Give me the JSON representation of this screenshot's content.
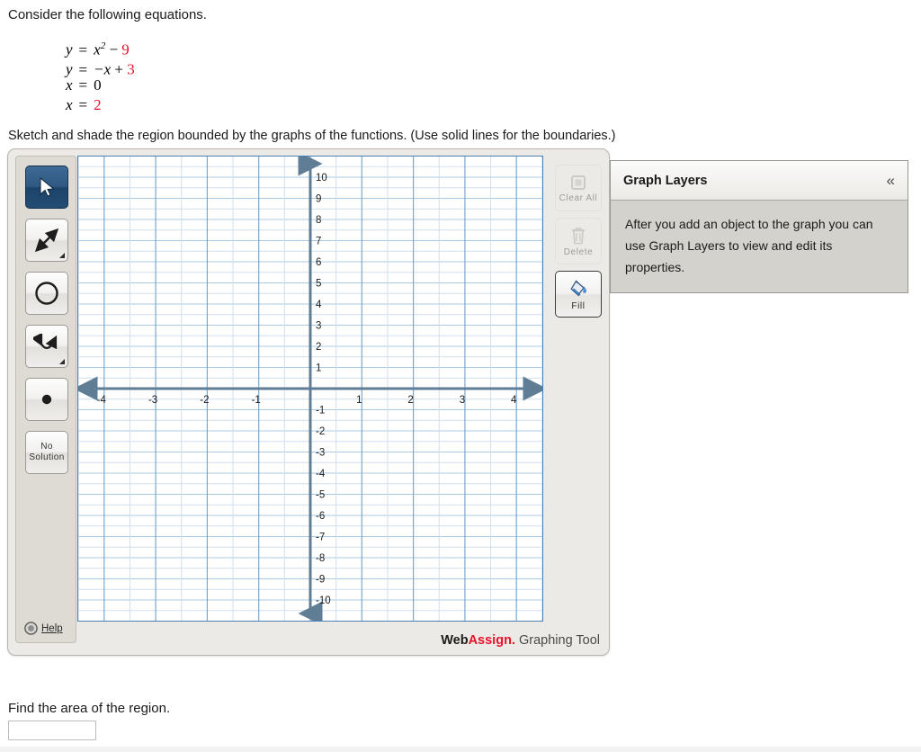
{
  "problem": {
    "intro": "Consider the following equations.",
    "equations": [
      {
        "lhs": "y",
        "rel": "=",
        "rhs_plain_1": "x",
        "exponent": "2",
        "rhs_plain_2": " − ",
        "rhs_red": "9"
      },
      {
        "lhs": "y",
        "rel": "=",
        "rhs_plain_1": "−x",
        "exponent": "",
        "rhs_plain_2": " + ",
        "rhs_red": "3"
      },
      {
        "lhs": "x",
        "rel": "=",
        "rhs_plain_1": "",
        "exponent": "",
        "rhs_plain_2": "",
        "rhs_red": "0"
      },
      {
        "lhs": "x",
        "rel": "=",
        "rhs_plain_1": "",
        "exponent": "",
        "rhs_plain_2": "",
        "rhs_red": "2"
      }
    ],
    "sketch_instruction": "Sketch and shade the region bounded by the graphs of the functions. (Use solid lines for the boundaries.)",
    "find_area_label": "Find the area of the region.",
    "answer_value": "",
    "answer_placeholder": ""
  },
  "graph_tool": {
    "left_toolbar": [
      {
        "name": "select-tool",
        "icon": "cursor-arrow-icon",
        "label": "",
        "active": true,
        "has_dropdown": false
      },
      {
        "name": "line-tool",
        "icon": "line-arrow-icon",
        "label": "",
        "active": false,
        "has_dropdown": true
      },
      {
        "name": "circle-tool",
        "icon": "circle-icon",
        "label": "",
        "active": false,
        "has_dropdown": false
      },
      {
        "name": "parabola-tool",
        "icon": "parabola-icon",
        "label": "",
        "active": false,
        "has_dropdown": true
      },
      {
        "name": "point-tool",
        "icon": "dot-icon",
        "label": "",
        "active": false,
        "has_dropdown": false
      },
      {
        "name": "no-solution-tool",
        "icon": "",
        "label": "No\nSolution",
        "active": false,
        "has_dropdown": false
      }
    ],
    "no_solution_line1": "No",
    "no_solution_line2": "Solution",
    "help_label": "Help",
    "right_toolbar": [
      {
        "name": "clear-all-button",
        "icon": "clear-all-icon",
        "label": "Clear All",
        "enabled": false
      },
      {
        "name": "delete-button",
        "icon": "trash-icon",
        "label": "Delete",
        "enabled": false
      },
      {
        "name": "fill-button",
        "icon": "paint-bucket-icon",
        "label": "Fill",
        "enabled": true
      }
    ],
    "branding": {
      "web": "Web",
      "assign": "Assign.",
      "tool": " Graphing Tool"
    }
  },
  "graph_layers": {
    "title": "Graph Layers",
    "collapse_icon": "«",
    "body_text": "After you add an object to the graph you can use Graph Layers to view and edit its properties."
  },
  "chart_data": {
    "type": "scatter",
    "title": "",
    "xlabel": "",
    "ylabel": "",
    "xlim": [
      -4.5,
      4.5
    ],
    "ylim": [
      -10.8,
      10.8
    ],
    "x_ticks": [
      -4,
      -3,
      -2,
      -1,
      1,
      2,
      3,
      4
    ],
    "y_ticks": [
      10,
      9,
      8,
      7,
      6,
      5,
      4,
      3,
      2,
      1,
      -1,
      -2,
      -3,
      -4,
      -5,
      -6,
      -7,
      -8,
      -9,
      -10
    ],
    "grid": true,
    "legend": "none",
    "series": [],
    "colors": {
      "grid_minor": "#cfe0ef",
      "grid_major": "#7ba9d0",
      "axis": "#5f7d94",
      "canvas_border": "#4a7fb5",
      "background": "#ffffff"
    }
  },
  "colors": {
    "red_accent": "#e8122b",
    "tool_active": "#2f5982",
    "panel_bg": "#eceae6",
    "layers_bg": "#d4d2cc"
  }
}
